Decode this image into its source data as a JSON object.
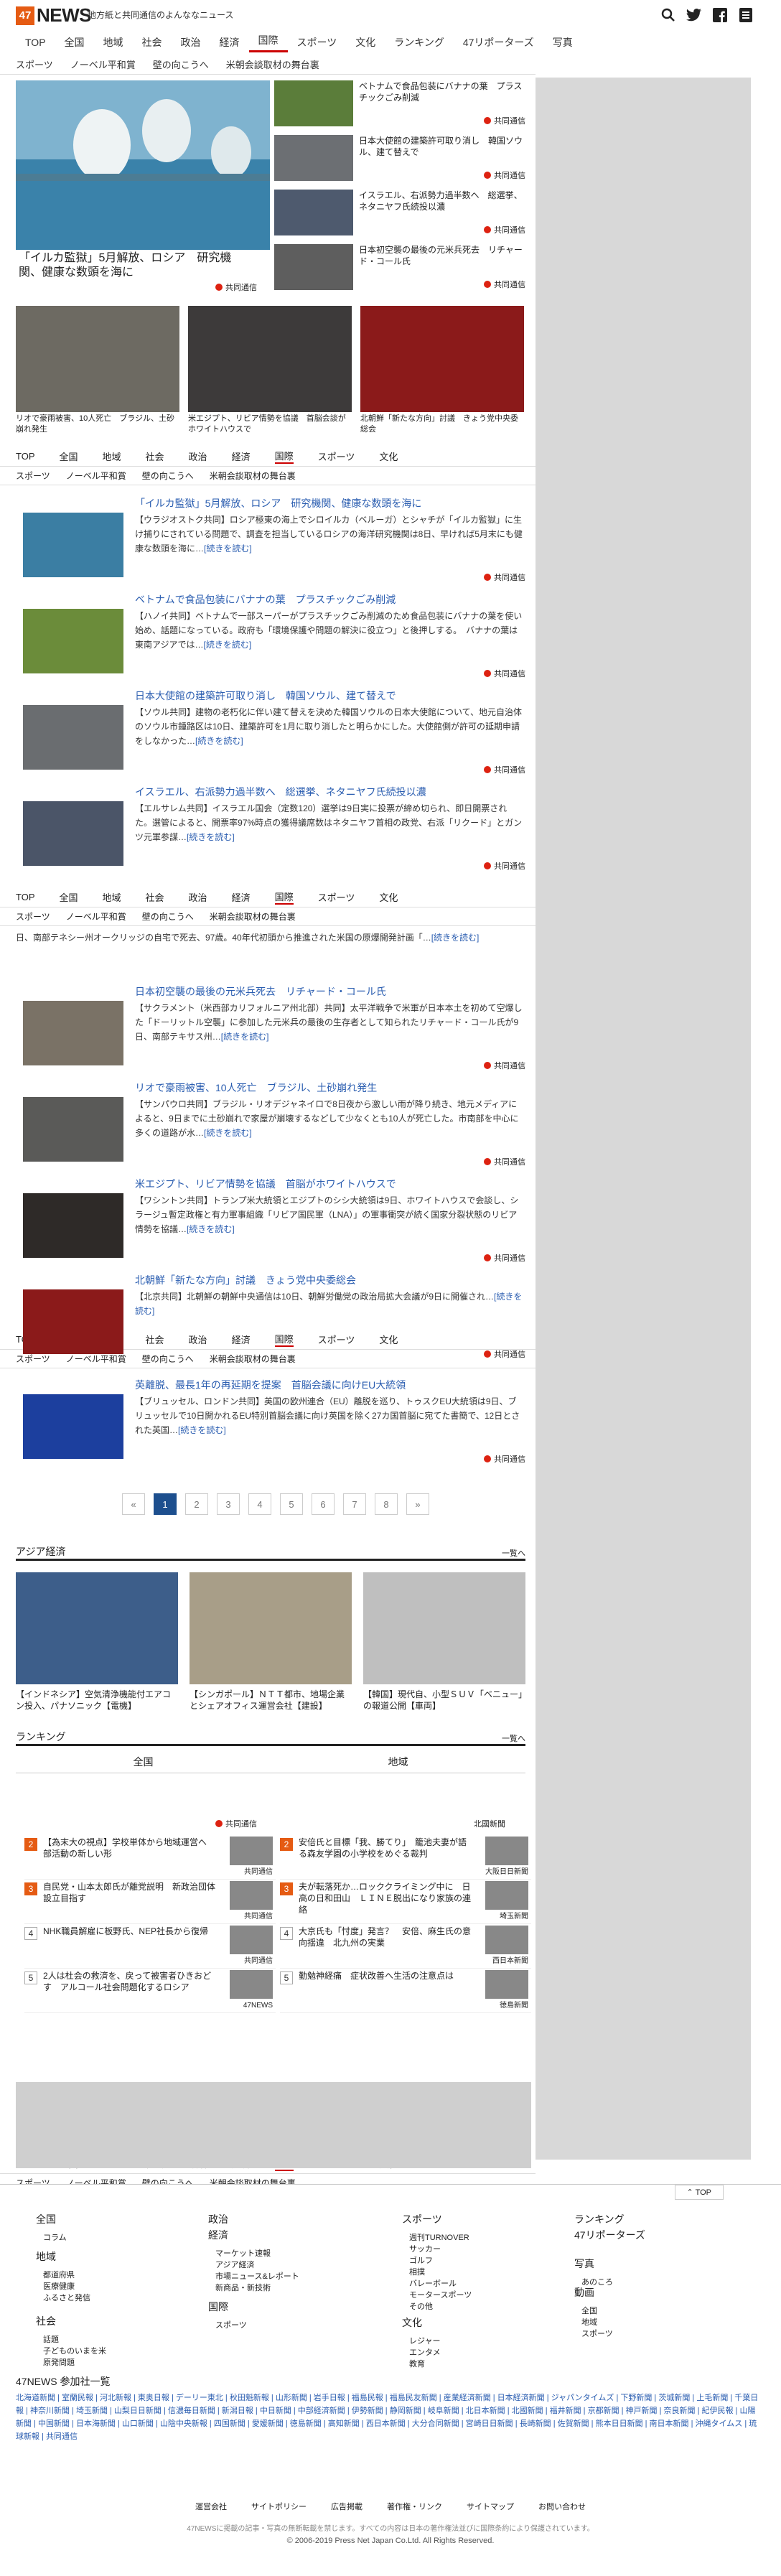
{
  "header": {
    "logo_box": "47",
    "logo_text": "NEWS",
    "tagline": "地方紙と共同通信のよんななニュース"
  },
  "nav": {
    "items": [
      "TOP",
      "全国",
      "地域",
      "社会",
      "政治",
      "経済",
      "国際",
      "スポーツ",
      "文化",
      "ランキング",
      "47リポーターズ",
      "写真"
    ],
    "active": "国際",
    "sub": [
      "スポーツ",
      "ノーベル平和賞",
      "壁の向こうへ",
      "米朝会談取材の舞台裏"
    ]
  },
  "top": {
    "big_caption": "「イルカ監獄」5月解放、ロシア　研究機関、健康な数頭を海に",
    "credit": "共同通信",
    "side": [
      "ベトナムで食品包装にバナナの葉　プラスチックごみ削減",
      "日本大使館の建築許可取り消し　韓国ソウル、建て替えで",
      "イスラエル、右派勢力過半数へ　総選挙、ネタニヤフ氏続投以濃",
      "日本初空襲の最後の元米兵死去　リチャード・コール氏"
    ],
    "grid": [
      "リオで豪雨被害、10人死亡　ブラジル、土砂崩れ発生",
      "米エジプト、リビア情勢を協議　首脳会談がホワイトハウスで",
      "北朝鮮「新たな方向」討議　きょう党中央委総会"
    ]
  },
  "nav_repeat": {
    "r1": [
      "TOP",
      "全国",
      "地域",
      "社会",
      "政治",
      "経済",
      "国際",
      "スポーツ",
      "文化"
    ],
    "r2": [
      "スポーツ",
      "ノーベル平和賞",
      "壁の向こうへ",
      "米朝会談取材の舞台裏"
    ]
  },
  "articles": [
    {
      "title": "「イルカ監獄」5月解放、ロシア　研究機関、健康な数頭を海に",
      "body": "【ウラジオストク共同】ロシア極東の海上でシロイルカ（ベルーガ）とシャチが「イルカ監獄」に生け捕りにされている問題で、調査を担当しているロシアの海洋研究機関は8日、早ければ5月末にも健康な数頭を海に…",
      "more": "[続きを読む]",
      "credit": "共同通信"
    },
    {
      "title": "ベトナムで食品包装にバナナの葉　プラスチックごみ削減",
      "body": "【ハノイ共同】ベトナムで一部スーパーがプラスチックごみ削減のため食品包装にバナナの葉を使い始め、話題になっている。政府も「環境保護や問題の解決に役立つ」と後押しする。　バナナの葉は東南アジアでは…",
      "more": "[続きを読む]",
      "credit": "共同通信"
    },
    {
      "title": "日本大使館の建築許可取り消し　韓国ソウル、建て替えで",
      "body": "【ソウル共同】建物の老朽化に伴い建て替えを決めた韓国ソウルの日本大使館について、地元自治体のソウル市鍾路区は10日、建築許可を1月に取り消したと明らかにした。大使館側が許可の延期申請をしなかった…",
      "more": "[続きを読む]",
      "credit": "共同通信"
    },
    {
      "title": "イスラエル、右派勢力過半数へ　総選挙、ネタニヤフ氏続投以濃",
      "body": "【エルサレム共同】イスラエル国会（定数120）選挙は9日実に投票が締め切られ、即日開票された。選管によると、開票率97%時点の獲得議席数はネタニヤフ首相の政党、右派「リクード」とガンツ元軍参謀…",
      "more": "[続きを読む]",
      "credit": "共同通信"
    },
    {
      "title": "日本初空襲の最後の元米兵死去　リチャード・コール氏",
      "body": "【サクラメント（米西部カリフォルニア州北部）共同】太平洋戦争で米軍が日本本土を初めて空爆した「ドーリットル空襲」に参加した元米兵の最後の生存者として知られたリチャード・コール氏が9日、南部テキサス州…",
      "more": "[続きを読む]",
      "credit": "共同通信"
    },
    {
      "title": "リオで豪雨被害、10人死亡　ブラジル、土砂崩れ発生",
      "body": "【サンパウロ共同】ブラジル・リオデジャネイロで8日夜から激しい雨が降り続き、地元メディアによると、9日までに土砂崩れで家屋が崩壊するなどして少なくとも10人が死亡した。市南部を中心に多くの道路が水…",
      "more": "[続きを読む]",
      "credit": "共同通信"
    },
    {
      "title": "米エジプト、リビア情勢を協議　首脳がホワイトハウスで",
      "body": "【ワシントン共同】トランプ米大統領とエジプトのシシ大統領は9日、ホワイトハウスで会談し、シラージュ暫定政権と有力軍事組織「リビア国民軍（LNA）」の軍事衝突が続く国家分裂状態のリビア情勢を協議…",
      "more": "[続きを読む]",
      "credit": "共同通信"
    },
    {
      "title": "北朝鮮「新たな方向」討議　きょう党中央委総会",
      "body": "【北京共同】北朝鮮の朝鮮中央通信は10日、朝鮮労働党の政治局拡大会議が9日に開催され…",
      "more": "[続きを読む]",
      "credit": "共同通信"
    },
    {
      "title": "英離脱、最長1年の再延期を提案　首脳会議に向けEU大統領",
      "body": "【ブリュッセル、ロンドン共同】英国の欧州連合（EU）離脱を巡り、トゥスクEU大統領は9日、ブリュッセルで10日開かれるEU特別首脳会議に向け英国を除く27カ国首脳に宛てた書簡で、12日とされた英国…",
      "more": "[続きを読む]",
      "credit": "共同通信"
    }
  ],
  "partial_article_text": "日、南部テネシー州オークリッジの自宅で死去、97歳。40年代初頭から推進された米国の原爆開発計画「…",
  "partial_more": "[続きを読む]",
  "pager": [
    "«",
    "1",
    "2",
    "3",
    "4",
    "5",
    "6",
    "7",
    "8",
    "»"
  ],
  "asia": {
    "title": "アジア経済",
    "more": "一覧へ",
    "cards": [
      "【インドネシア】空気清浄機能付エアコン投入、パナソニック【電機】",
      "【シンガポール】ＮＴＴ都市、地場企業とシェアオフィス運営会社【建設】",
      "【韓国】現代自、小型ＳＵＶ「ベニュー」の報道公開【車両】"
    ]
  },
  "ranking": {
    "title": "ランキング",
    "more": "一覧へ",
    "tabs": [
      "全国",
      "地域"
    ],
    "left": [
      {
        "n": "2",
        "t": "【為末大の視点】学校単体から地域運営へ　部活動の新しい形",
        "s": "共同通信"
      },
      {
        "n": "3",
        "t": "自民党・山本太郎氏が離党説明　新政治団体設立目指す",
        "s": "共同通信"
      },
      {
        "n": "4",
        "t": "NHK職員解雇に板野氏、NEP社長から復帰",
        "s": "共同通信"
      },
      {
        "n": "5",
        "t": "2人は杜会の救済を、戻って被害者ひきおどす　アルコール社会問題化するロシア",
        "s": "47NEWS"
      }
    ],
    "right": [
      {
        "n": "2",
        "t": "安倍氏と目標「我、勝てり」　籠池夫妻が語る森友学園の小学校をめぐる裁判",
        "s": "大阪日日新聞"
      },
      {
        "n": "3",
        "t": "夫が転落死か…ロッククライミング中に　日高の日和田山　ＬＩＮＥ脱出になり家族の連絡",
        "s": "埼玉新聞"
      },
      {
        "n": "4",
        "t": "大京氏も「忖度」発言？　安倍、麻生氏の意向揺違　北九州の実業",
        "s": "西日本新聞"
      },
      {
        "n": "5",
        "t": "勤勉神経痛　症状改善へ生活の注意点は",
        "s": "徳島新聞"
      }
    ],
    "top_right_src": "北國新聞",
    "top_left_src": "共同通信"
  },
  "footer": {
    "to_top": "TOP",
    "cols": [
      {
        "h": "全国",
        "s": [
          "コラム"
        ]
      },
      {
        "h": "地域",
        "s": [
          "都道府県",
          "医療健康",
          "ふるさと発信"
        ]
      },
      {
        "h": "社会",
        "s": [
          "話題",
          "子どものいまを米",
          "原発問題"
        ]
      },
      {
        "h": "政治",
        "s": []
      },
      {
        "h": "経済",
        "s": [
          "マーケット速報",
          "アジア経済",
          "市場ニュース&レポート",
          "新商品・新技術"
        ]
      },
      {
        "h": "国際",
        "s": [
          "スポーツ"
        ]
      },
      {
        "h": "スポーツ",
        "s": [
          "週刊TURNOVER",
          "サッカー",
          "ゴルフ",
          "相撲",
          "バレーボール",
          "モータースポーツ",
          "その他"
        ]
      },
      {
        "h": "文化",
        "s": [
          "レジャー",
          "エンタメ",
          "教育"
        ]
      },
      {
        "h": "ランキング",
        "s": []
      },
      {
        "h": "47リポーターズ",
        "s": []
      },
      {
        "h": "写真",
        "s": [
          "あのころ"
        ]
      },
      {
        "h": "動画",
        "s": [
          "全国",
          "地域",
          "スポーツ"
        ]
      }
    ],
    "partners_title": "47NEWS 参加社一覧",
    "partners": "北海道新聞 | 室蘭民報 | 河北新報 | 東奥日報 | デーリー東北 | 秋田魁新報 | 山形新聞 | 岩手日報 | 福島民報 | 福島民友新聞 | 産業経済新聞 | 日本経済新聞 | ジャパンタイムズ | 下野新聞 | 茨城新聞 | 上毛新聞 | 千葉日報 | 神奈川新聞 | 埼玉新聞 | 山梨日日新聞 | 信濃毎日新聞 | 新潟日報 | 中日新聞 | 中部経済新聞 | 伊勢新聞 | 静岡新聞 | 岐阜新聞 | 北日本新聞 | 北國新聞 | 福井新聞 | 京都新聞 | 神戸新聞 | 奈良新聞 | 紀伊民報 | 山陽新聞 | 中国新聞 | 日本海新聞 | 山口新聞 | 山陰中央新報 | 四国新聞 | 愛媛新聞 | 徳島新聞 | 高知新聞 | 西日本新聞 | 大分合同新聞 | 宮崎日日新聞 | 長崎新聞 | 佐賀新聞 | 熊本日日新聞 | 南日本新聞 | 沖縄タイムス | 琉球新報 | 共同通信",
    "links": [
      "運営会社",
      "サイトポリシー",
      "広告掲載",
      "著作権・リンク",
      "サイトマップ",
      "お問い合わせ"
    ],
    "copy1": "47NEWSに掲載の記事・写真の無断転載を禁じます。すべての内容は日本の著作権法並びに国際条約により保護されています。",
    "copy2": "© 2006-2019 Press Net Japan Co.Ltd. All Rights Reserved."
  }
}
